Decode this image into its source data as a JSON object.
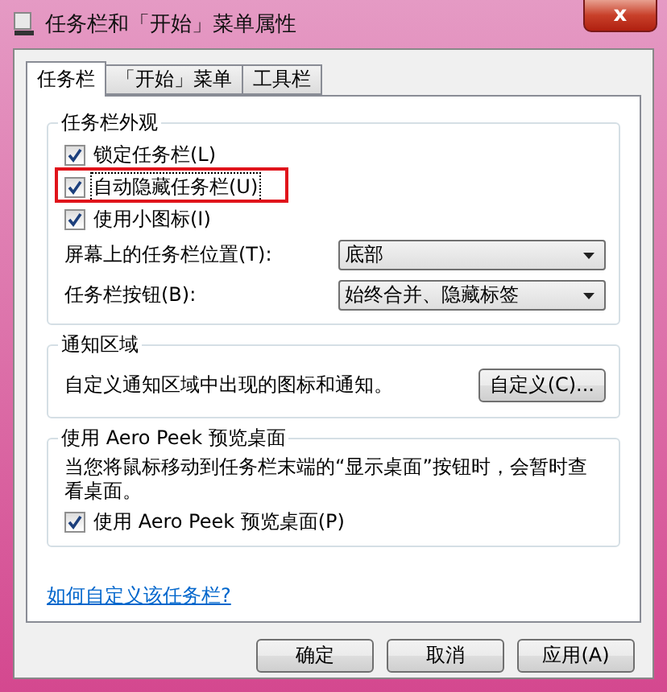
{
  "window": {
    "title": "任务栏和「开始」菜单属性",
    "close": "x"
  },
  "tabs": [
    {
      "label": "任务栏",
      "selected": true
    },
    {
      "label": "「开始」菜单",
      "selected": false
    },
    {
      "label": "工具栏",
      "selected": false
    }
  ],
  "groups": [
    {
      "title": "任务栏外观",
      "rows": [
        {
          "kind": "checkbox",
          "label": "锁定任务栏(L)",
          "checked": true,
          "focused": false,
          "highlighted": false
        },
        {
          "kind": "checkbox",
          "label": "自动隐藏任务栏(U)",
          "checked": true,
          "focused": true,
          "highlighted": true
        },
        {
          "kind": "checkbox",
          "label": "使用小图标(I)",
          "checked": true,
          "focused": false,
          "highlighted": false
        },
        {
          "kind": "select",
          "label": "屏幕上的任务栏位置(T):",
          "value": "底部"
        },
        {
          "kind": "select",
          "label": "任务栏按钮(B):",
          "value": "始终合并、隐藏标签"
        }
      ]
    },
    {
      "title": "通知区域",
      "rows": [
        {
          "kind": "text_button",
          "text": "自定义通知区域中出现的图标和通知。",
          "button": "自定义(C)..."
        }
      ]
    },
    {
      "title": "使用 Aero Peek 预览桌面",
      "rows": [
        {
          "kind": "text",
          "text": "当您将鼠标移动到任务栏末端的“显示桌面”按钮时，会暂时查看桌面。"
        },
        {
          "kind": "checkbox",
          "label": "使用 Aero Peek 预览桌面(P)",
          "checked": true,
          "focused": false,
          "highlighted": false
        }
      ]
    }
  ],
  "link": "如何自定义该任务栏?",
  "buttons": [
    "确定",
    "取消",
    "应用(A)"
  ]
}
